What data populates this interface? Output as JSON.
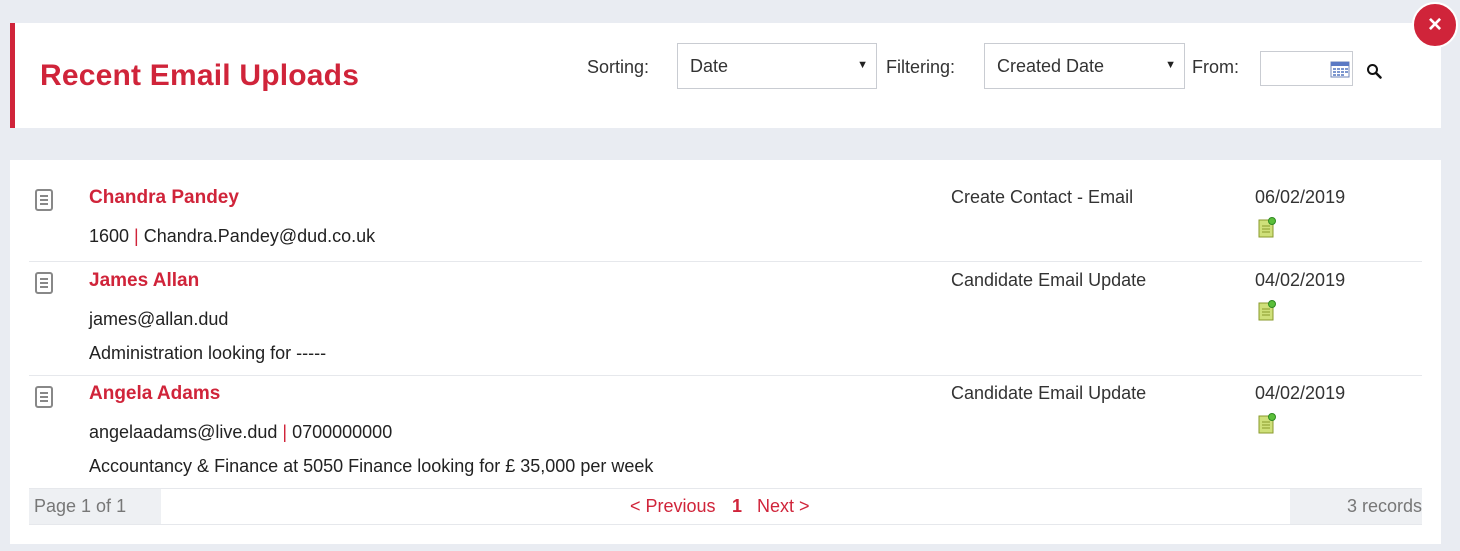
{
  "header": {
    "title": "Recent Email Uploads",
    "sorting_label": "Sorting:",
    "sorting_value": "Date",
    "filtering_label": "Filtering:",
    "filtering_value": "Created Date",
    "from_label": "From:",
    "from_value": ""
  },
  "close_label": "×",
  "rows": [
    {
      "name": "Chandra Pandey",
      "line1_a": "1600",
      "line1_sep": " | ",
      "line1_b": "Chandra.Pandey@dud.co.uk",
      "line2": "",
      "type": "Create Contact - Email",
      "date": "06/02/2019"
    },
    {
      "name": "James Allan",
      "line1_a": "james@allan.dud",
      "line1_sep": "",
      "line1_b": "",
      "line2": "Administration looking for -----",
      "type": "Candidate Email Update",
      "date": "04/02/2019"
    },
    {
      "name": "Angela Adams",
      "line1_a": "angelaadams@live.dud",
      "line1_sep": " | ",
      "line1_b": "0700000000",
      "line2": "Accountancy & Finance at 5050 Finance looking for £ 35,000 per week",
      "type": "Candidate Email Update",
      "date": "04/02/2019"
    }
  ],
  "pager": {
    "page_info": "Page 1 of 1",
    "previous": "< Previous",
    "current": "1",
    "next": "Next >",
    "records": "3 records"
  },
  "colors": {
    "accent": "#d0243a",
    "background": "#e9ecf2"
  }
}
